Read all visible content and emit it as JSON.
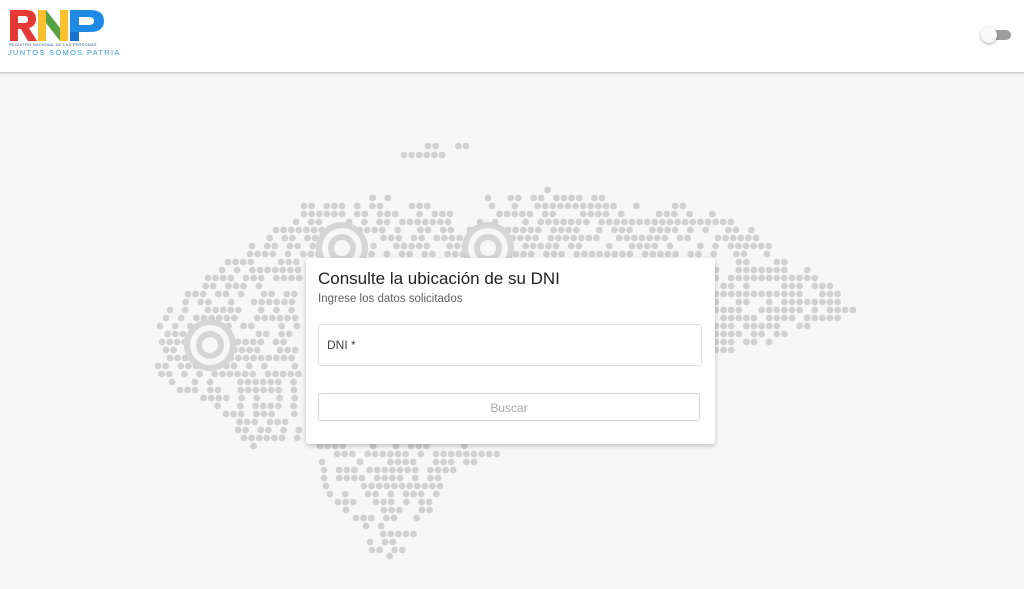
{
  "header": {
    "logo": {
      "wordmark": "RNP",
      "registry_text": "REGISTRO NACIONAL DE LAS PERSONAS",
      "tagline": "JUNTOS SOMOS PATRIA",
      "letter_colors": [
        "#e53935",
        "#fbc02d",
        "#43a047",
        "#1e88e5"
      ]
    },
    "theme_toggle": {
      "state": "off"
    }
  },
  "background": {
    "map_icon": "honduras-dot-map",
    "dot_color": "#d2d2d2"
  },
  "card": {
    "title": "Consulte la ubicación de su DNI",
    "subtitle": "Ingrese los datos solicitados",
    "dni_field": {
      "label": "DNI *",
      "value": ""
    },
    "search_button_label": "Buscar"
  }
}
